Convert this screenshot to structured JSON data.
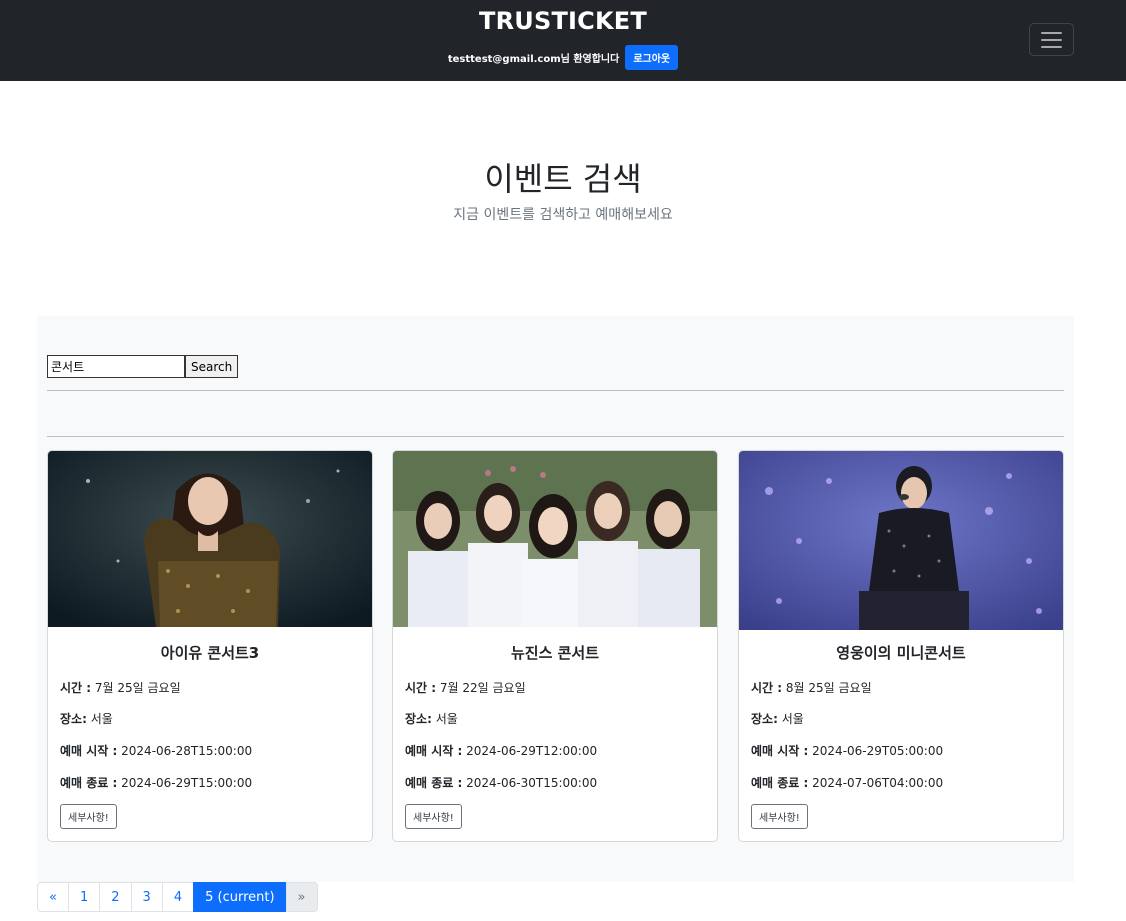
{
  "navbar": {
    "brand": "TRUSTICKET",
    "greeting": "testtest@gmail.com님 환영합니다",
    "logout_label": "로그아웃"
  },
  "hero": {
    "title": "이벤트 검색",
    "subtitle": "지금 이벤트를 검색하고 예매해보세요"
  },
  "search": {
    "value": "콘서트",
    "button_label": "Search"
  },
  "cards": [
    {
      "title": "아이유 콘서트3",
      "time_label": "시간 :",
      "time": "7월 25일 금요일",
      "place_label": "장소:",
      "place": "서울",
      "start_label": "예매 시작 :",
      "start": "2024-06-28T15:00:00",
      "end_label": "예매 종료 :",
      "end": "2024-06-29T15:00:00",
      "button_label": "세부사항!"
    },
    {
      "title": "뉴진스 콘서트",
      "time_label": "시간 :",
      "time": "7월 22일 금요일",
      "place_label": "장소:",
      "place": "서울",
      "start_label": "예매 시작 :",
      "start": "2024-06-29T12:00:00",
      "end_label": "예매 종료 :",
      "end": "2024-06-30T15:00:00",
      "button_label": "세부사항!"
    },
    {
      "title": "영웅이의 미니콘서트",
      "time_label": "시간 :",
      "time": "8월 25일 금요일",
      "place_label": "장소:",
      "place": "서울",
      "start_label": "예매 시작 :",
      "start": "2024-06-29T05:00:00",
      "end_label": "예매 종료 :",
      "end": "2024-07-06T04:00:00",
      "button_label": "세부사항!"
    }
  ],
  "pagination": {
    "prev": "«",
    "pages": [
      "1",
      "2",
      "3",
      "4"
    ],
    "current": "5 (current)",
    "next": "»"
  },
  "colors": {
    "navbar_bg": "#212529",
    "accent": "#0d6efd",
    "panel_bg": "#f8f9fa"
  }
}
